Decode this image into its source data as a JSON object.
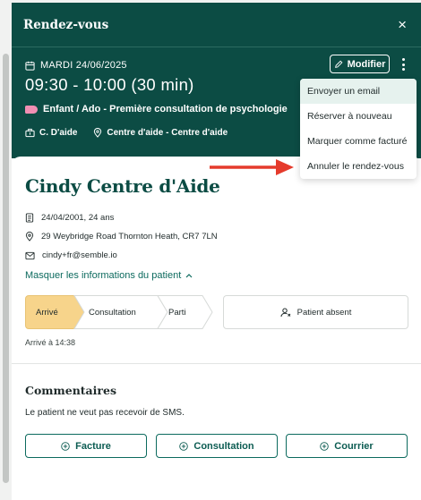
{
  "header": {
    "title": "Rendez-vous",
    "close_label": "×",
    "date": "MARDI 24/06/2025",
    "time": "09:30 - 10:00  (30 min)",
    "appointment_type": "Enfant / Ado - Première consultation de psychologie",
    "practitioner": "C. D'aide",
    "location": "Centre d'aide - Centre d'aide",
    "modify_label": "Modifier",
    "tag_color": "#f08fb3"
  },
  "menu": {
    "items": [
      {
        "label": "Envoyer un email"
      },
      {
        "label": "Réserver à nouveau"
      },
      {
        "label": "Marquer comme facturé"
      },
      {
        "label": "Annuler le rendez-vous"
      }
    ]
  },
  "patient": {
    "name": "Cindy Centre d'Aide",
    "dob": "24/04/2001, 24 ans",
    "address": "29 Weybridge Road Thornton Heath, CR7 7LN",
    "email": "cindy+fr@semble.io",
    "toggle_label": "Masquer les informations du patient"
  },
  "status": {
    "steps": [
      {
        "label": "Arrivé"
      },
      {
        "label": "Consultation"
      },
      {
        "label": "Parti"
      }
    ],
    "active_step": "Arrivé",
    "absent_label": "Patient absent",
    "arrival_note": "Arrivé à 14:38"
  },
  "comments": {
    "title": "Commentaires",
    "text": "Le patient ne veut pas recevoir de SMS."
  },
  "actions": {
    "invoice": "Facture",
    "consultation": "Consultation",
    "letter": "Courrier"
  },
  "colors": {
    "primary": "#0c4c44",
    "accent": "#0c6a5e",
    "active_step": "#f7d48b",
    "annotation_arrow": "#e53b2c"
  }
}
